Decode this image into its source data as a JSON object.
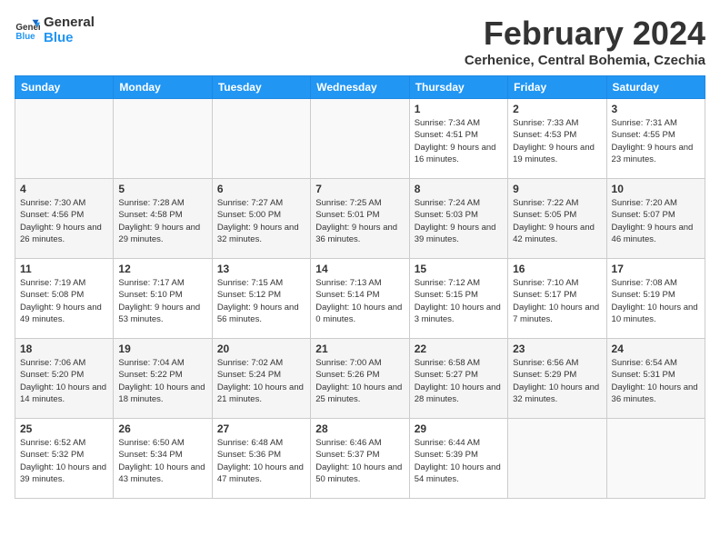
{
  "header": {
    "logo_line1": "General",
    "logo_line2": "Blue",
    "month_year": "February 2024",
    "location": "Cerhenice, Central Bohemia, Czechia"
  },
  "weekdays": [
    "Sunday",
    "Monday",
    "Tuesday",
    "Wednesday",
    "Thursday",
    "Friday",
    "Saturday"
  ],
  "weeks": [
    [
      {
        "day": "",
        "empty": true
      },
      {
        "day": "",
        "empty": true
      },
      {
        "day": "",
        "empty": true
      },
      {
        "day": "",
        "empty": true
      },
      {
        "day": "1",
        "sunrise": "7:34 AM",
        "sunset": "4:51 PM",
        "daylight": "9 hours and 16 minutes."
      },
      {
        "day": "2",
        "sunrise": "7:33 AM",
        "sunset": "4:53 PM",
        "daylight": "9 hours and 19 minutes."
      },
      {
        "day": "3",
        "sunrise": "7:31 AM",
        "sunset": "4:55 PM",
        "daylight": "9 hours and 23 minutes."
      }
    ],
    [
      {
        "day": "4",
        "sunrise": "7:30 AM",
        "sunset": "4:56 PM",
        "daylight": "9 hours and 26 minutes."
      },
      {
        "day": "5",
        "sunrise": "7:28 AM",
        "sunset": "4:58 PM",
        "daylight": "9 hours and 29 minutes."
      },
      {
        "day": "6",
        "sunrise": "7:27 AM",
        "sunset": "5:00 PM",
        "daylight": "9 hours and 32 minutes."
      },
      {
        "day": "7",
        "sunrise": "7:25 AM",
        "sunset": "5:01 PM",
        "daylight": "9 hours and 36 minutes."
      },
      {
        "day": "8",
        "sunrise": "7:24 AM",
        "sunset": "5:03 PM",
        "daylight": "9 hours and 39 minutes."
      },
      {
        "day": "9",
        "sunrise": "7:22 AM",
        "sunset": "5:05 PM",
        "daylight": "9 hours and 42 minutes."
      },
      {
        "day": "10",
        "sunrise": "7:20 AM",
        "sunset": "5:07 PM",
        "daylight": "9 hours and 46 minutes."
      }
    ],
    [
      {
        "day": "11",
        "sunrise": "7:19 AM",
        "sunset": "5:08 PM",
        "daylight": "9 hours and 49 minutes."
      },
      {
        "day": "12",
        "sunrise": "7:17 AM",
        "sunset": "5:10 PM",
        "daylight": "9 hours and 53 minutes."
      },
      {
        "day": "13",
        "sunrise": "7:15 AM",
        "sunset": "5:12 PM",
        "daylight": "9 hours and 56 minutes."
      },
      {
        "day": "14",
        "sunrise": "7:13 AM",
        "sunset": "5:14 PM",
        "daylight": "10 hours and 0 minutes."
      },
      {
        "day": "15",
        "sunrise": "7:12 AM",
        "sunset": "5:15 PM",
        "daylight": "10 hours and 3 minutes."
      },
      {
        "day": "16",
        "sunrise": "7:10 AM",
        "sunset": "5:17 PM",
        "daylight": "10 hours and 7 minutes."
      },
      {
        "day": "17",
        "sunrise": "7:08 AM",
        "sunset": "5:19 PM",
        "daylight": "10 hours and 10 minutes."
      }
    ],
    [
      {
        "day": "18",
        "sunrise": "7:06 AM",
        "sunset": "5:20 PM",
        "daylight": "10 hours and 14 minutes."
      },
      {
        "day": "19",
        "sunrise": "7:04 AM",
        "sunset": "5:22 PM",
        "daylight": "10 hours and 18 minutes."
      },
      {
        "day": "20",
        "sunrise": "7:02 AM",
        "sunset": "5:24 PM",
        "daylight": "10 hours and 21 minutes."
      },
      {
        "day": "21",
        "sunrise": "7:00 AM",
        "sunset": "5:26 PM",
        "daylight": "10 hours and 25 minutes."
      },
      {
        "day": "22",
        "sunrise": "6:58 AM",
        "sunset": "5:27 PM",
        "daylight": "10 hours and 28 minutes."
      },
      {
        "day": "23",
        "sunrise": "6:56 AM",
        "sunset": "5:29 PM",
        "daylight": "10 hours and 32 minutes."
      },
      {
        "day": "24",
        "sunrise": "6:54 AM",
        "sunset": "5:31 PM",
        "daylight": "10 hours and 36 minutes."
      }
    ],
    [
      {
        "day": "25",
        "sunrise": "6:52 AM",
        "sunset": "5:32 PM",
        "daylight": "10 hours and 39 minutes."
      },
      {
        "day": "26",
        "sunrise": "6:50 AM",
        "sunset": "5:34 PM",
        "daylight": "10 hours and 43 minutes."
      },
      {
        "day": "27",
        "sunrise": "6:48 AM",
        "sunset": "5:36 PM",
        "daylight": "10 hours and 47 minutes."
      },
      {
        "day": "28",
        "sunrise": "6:46 AM",
        "sunset": "5:37 PM",
        "daylight": "10 hours and 50 minutes."
      },
      {
        "day": "29",
        "sunrise": "6:44 AM",
        "sunset": "5:39 PM",
        "daylight": "10 hours and 54 minutes."
      },
      {
        "day": "",
        "empty": true
      },
      {
        "day": "",
        "empty": true
      }
    ]
  ]
}
